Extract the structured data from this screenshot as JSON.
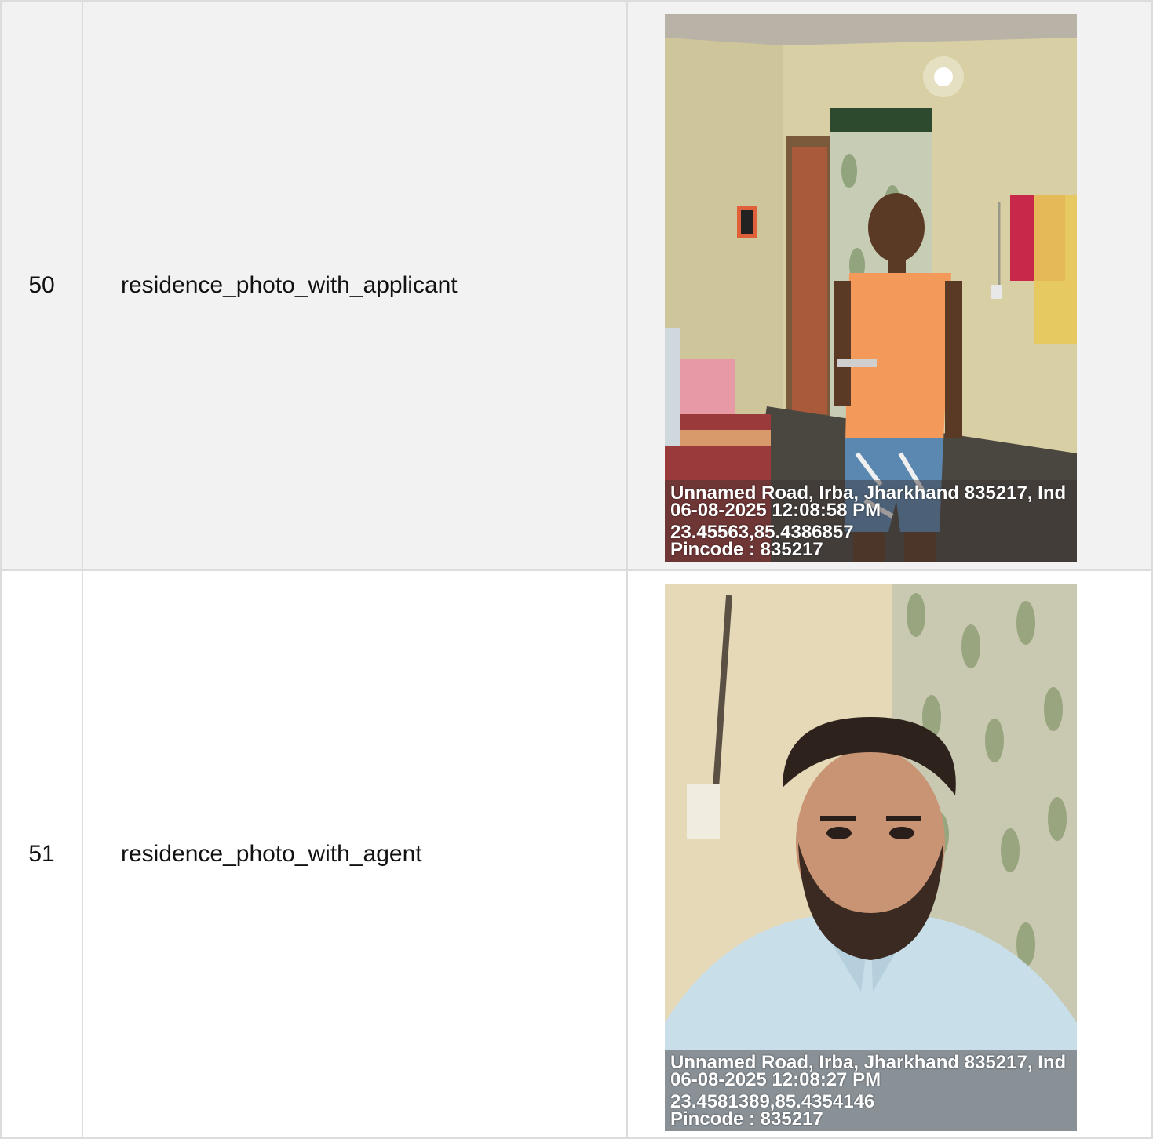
{
  "rows": [
    {
      "number": "50",
      "field": "residence_photo_with_applicant",
      "photo": {
        "stamp_address": "Unnamed Road, Irba, Jharkhand 835217, Ind",
        "stamp_datetime": "06-08-2025 12:08:58 PM",
        "stamp_coords": "23.45563,85.4386857",
        "stamp_pincode": "Pincode : 835217"
      }
    },
    {
      "number": "51",
      "field": "residence_photo_with_agent",
      "photo": {
        "stamp_address": "Unnamed Road, Irba, Jharkhand 835217, Ind",
        "stamp_datetime": "06-08-2025 12:08:27 PM",
        "stamp_coords": "23.4581389,85.4354146",
        "stamp_pincode": "Pincode : 835217"
      }
    }
  ]
}
